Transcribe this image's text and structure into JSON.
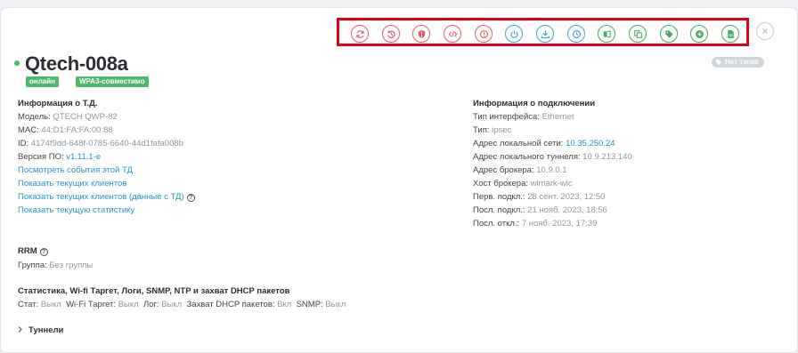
{
  "header": {
    "title": "Qtech-008a",
    "status_badge": "онлайн",
    "security_badge": "WPA3-совместимо",
    "tag_badge": "Нет тэгов",
    "status_color": "#4cb86c"
  },
  "toolbar": {
    "buttons": [
      {
        "icon": "refresh-icon",
        "color": "red"
      },
      {
        "icon": "undo-icon",
        "color": "red"
      },
      {
        "icon": "shield-icon",
        "color": "red"
      },
      {
        "icon": "code-icon",
        "color": "red"
      },
      {
        "icon": "stop-icon",
        "color": "red"
      },
      {
        "icon": "power-icon",
        "color": "blue"
      },
      {
        "icon": "download-icon",
        "color": "blue"
      },
      {
        "icon": "clock-icon",
        "color": "blue"
      },
      {
        "icon": "copy-file-icon",
        "color": "green"
      },
      {
        "icon": "duplicate-icon",
        "color": "green"
      },
      {
        "icon": "tag-icon",
        "color": "green"
      },
      {
        "icon": "add-circle-icon",
        "color": "green"
      },
      {
        "icon": "file-icon",
        "color": "green"
      }
    ]
  },
  "ap_info": {
    "title": "Информация о Т.Д.",
    "model_label": "Модель:",
    "model_value": "QTECH QWP-82",
    "mac_label": "MAC:",
    "mac_value": "44:D1:FA:FA:00:88",
    "id_label": "ID:",
    "id_value": "4174f9dd-648f-0785-6640-44d1fafa008b",
    "fw_label": "Версия ПО:",
    "fw_value": "v1.11.1-e",
    "link_events": "Посмотреть события этой ТД",
    "link_clients": "Показать текущих клиентов",
    "link_clients_ap": "Показать текущих клиентов (данные с ТД)",
    "link_stats": "Показать текущую статистику"
  },
  "connection": {
    "title": "Информация о подключении",
    "iface_label": "Тип интерфейса:",
    "iface_value": "Ethernet",
    "type_label": "Тип:",
    "type_value": "ipsec",
    "lan_label": "Адрес локальной сети:",
    "lan_value": "10.35.250.24",
    "tunnel_label": "Адрес локального туннеля:",
    "tunnel_value": "10.9.213.140",
    "broker_label": "Адрес брокера:",
    "broker_value": "10.9.0.1",
    "host_label": "Хост брокера:",
    "host_value": "wimark-wlc",
    "first_label": "Перв. подкл.:",
    "first_value": "28 сент. 2023, 12:50",
    "last_label": "Посл. подкл.:",
    "last_value": "21 нояб. 2023, 18:56",
    "disc_label": "Посл. откл.:",
    "disc_value": "7 нояб. 2023, 17:39"
  },
  "rrm": {
    "title": "RRM",
    "group_label": "Группа:",
    "group_value": "Без группы"
  },
  "stats": {
    "title": "Статистика, Wi-fi Таргет, Логи, SNMP, NTP и захват DHCP пакетов",
    "stat_label": "Стат:",
    "stat_value": "Выкл",
    "wifi_label": "Wi-Fi Таргет:",
    "wifi_value": "Выкл",
    "log_label": "Лог:",
    "log_value": "Выкл",
    "dhcp_label": "Захват DHCP пакетов:",
    "dhcp_value": "Вкл",
    "snmp_label": "SNMP:",
    "snmp_value": "Выкл"
  },
  "tunnels": {
    "title": "Туннели"
  }
}
